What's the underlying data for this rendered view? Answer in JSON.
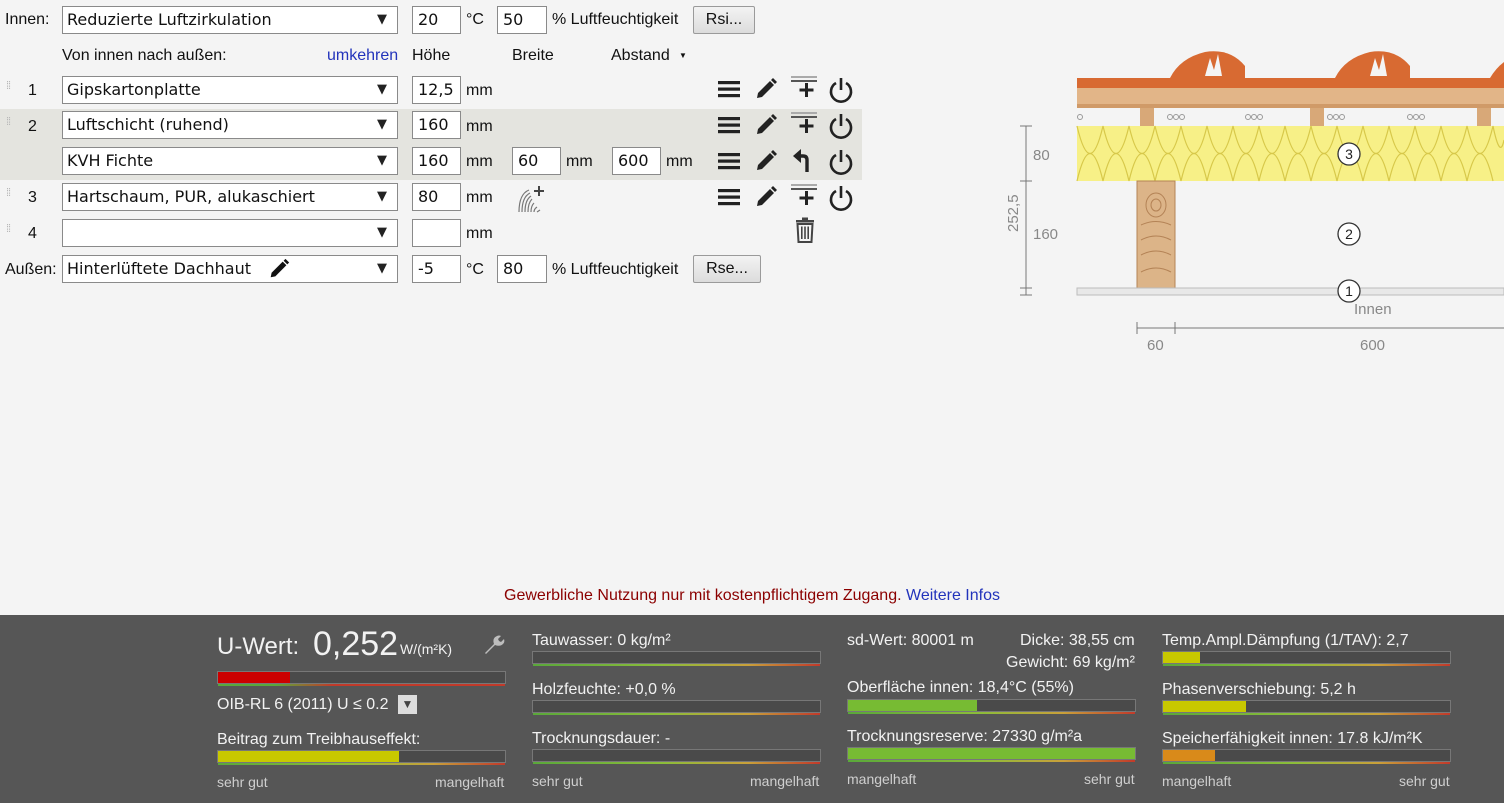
{
  "top": {
    "innen_label": "Innen:",
    "innen_climate": "Reduzierte Luftzirkulation",
    "innen_temp": "20",
    "innen_temp_unit": "°C",
    "innen_humidity": "50",
    "innen_humidity_label": "% Luftfeuchtigkeit",
    "rsi_button": "Rsi...",
    "direction_label": "Von innen nach außen:",
    "reverse_link": "umkehren",
    "col_height": "Höhe",
    "col_width": "Breite",
    "col_distance": "Abstand",
    "col_distance_caret": "▼"
  },
  "layers": [
    {
      "num": "1",
      "material": "Gipskartonplatte",
      "height": "12,5",
      "unit": "mm"
    },
    {
      "num": "2",
      "material": "Luftschicht (ruhend)",
      "height": "160",
      "unit": "mm",
      "sub": {
        "material": "KVH Fichte",
        "height": "160",
        "width": "60",
        "distance": "600",
        "unit": "mm"
      }
    },
    {
      "num": "3",
      "material": "Hartschaum, PUR, alukaschiert",
      "height": "80",
      "unit": "mm"
    },
    {
      "num": "4",
      "material": "",
      "height": "",
      "unit": "mm"
    }
  ],
  "bottom": {
    "aussen_label": "Außen:",
    "aussen_climate": "Hinterlüftete Dachhaut",
    "aussen_temp": "-5",
    "aussen_temp_unit": "°C",
    "aussen_humidity": "80",
    "aussen_humidity_label": "% Luftfeuchtigkeit",
    "rse_button": "Rse..."
  },
  "diagram": {
    "dim_80": "80",
    "dim_160": "160",
    "dim_total": "252,5",
    "label_innen": "Innen",
    "dim_60": "60",
    "dim_600": "600",
    "marker_1": "1",
    "marker_2": "2",
    "marker_3": "3"
  },
  "notice": {
    "text": "Gewerbliche Nutzung nur mit kostenpflichtigem Zugang.",
    "link": "Weitere Infos"
  },
  "results": {
    "u_label": "U-Wert:",
    "u_value": "0,252",
    "u_unit": "W/(m²K)",
    "oib": "OIB-RL 6 (2011) U ≤ 0.2",
    "treibhaus": "Beitrag zum Treibhauseffekt:",
    "tauwasser": "Tauwasser: 0 kg/m²",
    "holzfeuchte": "Holzfeuchte: +0,0 %",
    "trocknungsdauer": "Trocknungsdauer: -",
    "sd_wert": "sd-Wert: 80001 m",
    "dicke": "Dicke: 38,55 cm",
    "gewicht": "Gewicht: 69 kg/m²",
    "oberflaeche": "Oberfläche innen: 18,4°C (55%)",
    "trocknungsreserve": "Trocknungsreserve: 27330 g/m²a",
    "temp_ampl": "Temp.Ampl.Dämpfung (1/TAV): 2,7",
    "phasen": "Phasenverschiebung: 5,2 h",
    "speicher": "Speicherfähigkeit innen: 17.8 kJ/m²K",
    "sehr_gut": "sehr gut",
    "mangelhaft": "mangelhaft"
  },
  "bar_levels": {
    "u_wert": 0.25,
    "treibhaus": 0.63,
    "tauwasser": 0.0,
    "holzfeuchte": 0.0,
    "trocknungsdauer": 0.0,
    "oberflaeche": 0.45,
    "trocknungsreserve": 1.0,
    "temp_ampl": 0.13,
    "phasen": 0.29,
    "speicher": 0.18
  },
  "colors": {
    "panel_bg": "#565656",
    "bar_red": "#cc0000",
    "bar_yellow": "#c8c800",
    "bar_green": "#77bb33",
    "bar_orange": "#d98a1a",
    "notice_red": "#8b0000",
    "link_blue": "#2233bb"
  }
}
